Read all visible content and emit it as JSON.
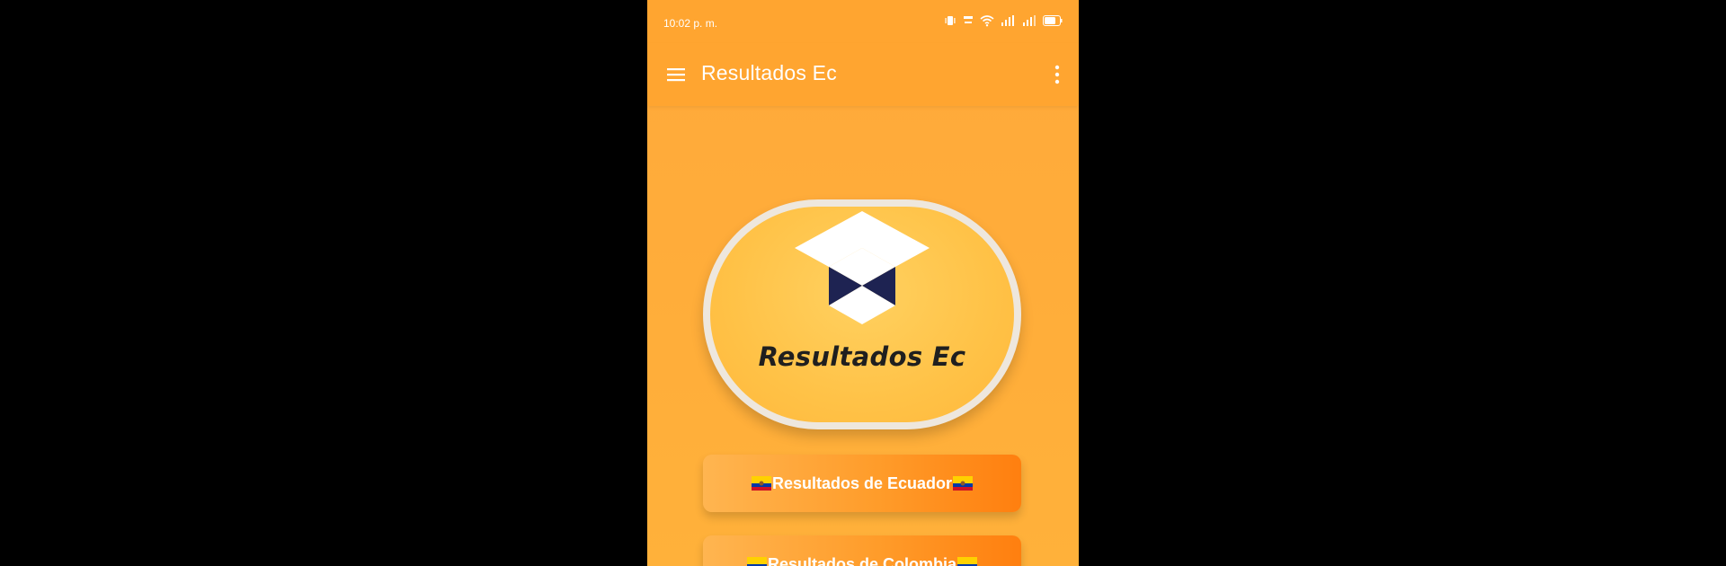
{
  "status_bar": {
    "time": "10:02 p. m."
  },
  "app_bar": {
    "title": "Resultados Ec"
  },
  "logo": {
    "text": "Resultados Ec"
  },
  "buttons": {
    "ecuador": "Resultados de Ecuador",
    "colombia": "Resultados de Colombia"
  },
  "colors": {
    "background": "#ffa93a",
    "app_bar": "#ffa530",
    "button_gradient_end": "#ff7f0f",
    "logo_navy": "#1e2352"
  },
  "icons": [
    "menu-icon",
    "more-vert-icon",
    "vibrate-icon",
    "wifi-icon",
    "signal-icon",
    "battery-icon",
    "ecuador-flag-icon",
    "colombia-flag-icon"
  ]
}
